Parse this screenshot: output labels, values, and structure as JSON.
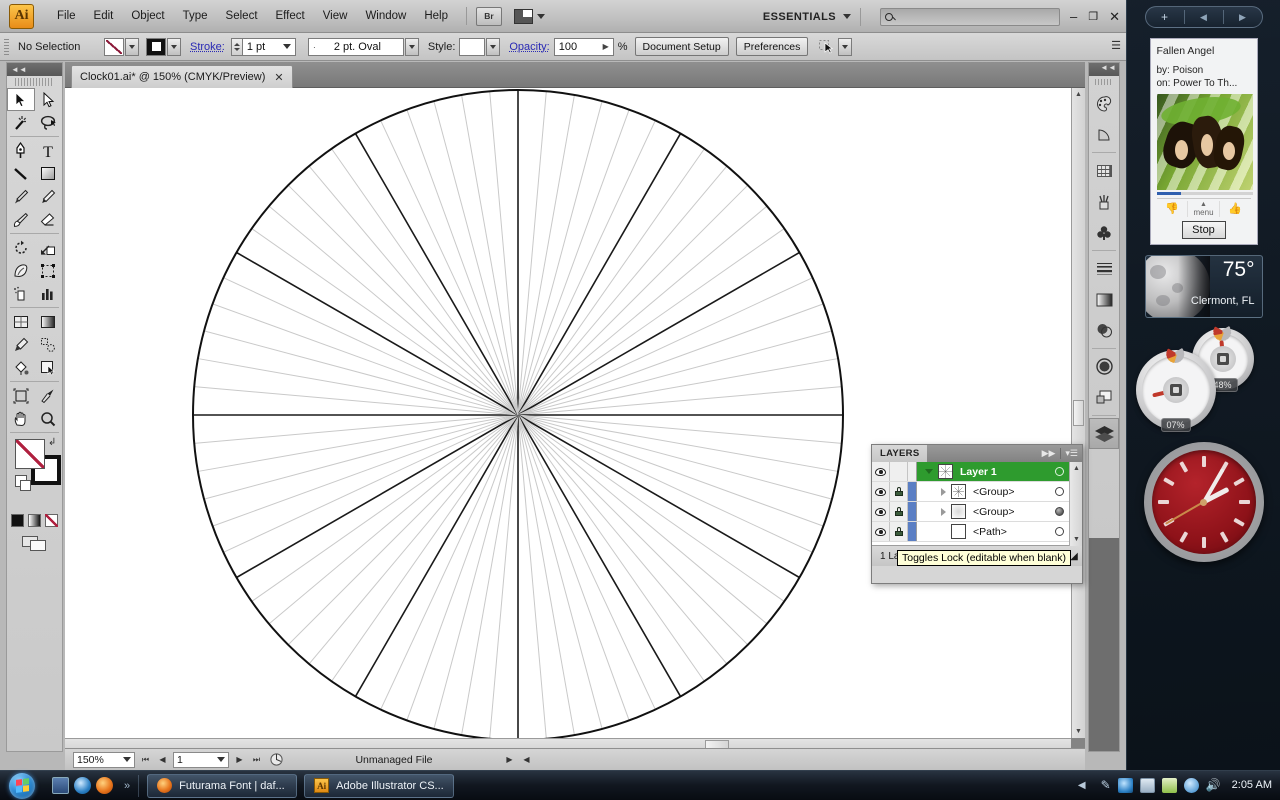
{
  "app": {
    "name": "Adobe Illustrator",
    "logo_text": "Ai",
    "menus": [
      "File",
      "Edit",
      "Object",
      "Type",
      "Select",
      "Effect",
      "View",
      "Window",
      "Help"
    ],
    "bridge_button": "Br",
    "workspace": "ESSENTIALS",
    "search_placeholder": "",
    "window_buttons": {
      "minimize": "–",
      "restore": "❐",
      "close": "✕"
    }
  },
  "control_bar": {
    "selection_status": "No Selection",
    "stroke_label": "Stroke:",
    "stroke_value": "1 pt",
    "brush_value": "2 pt. Oval",
    "style_label": "Style:",
    "opacity_label": "Opacity:",
    "opacity_value": "100",
    "percent": "%",
    "document_setup": "Document Setup",
    "preferences": "Preferences"
  },
  "document": {
    "tab_title": "Clock01.ai* @ 150% (CMYK/Preview)",
    "tab_close": "✕"
  },
  "status_bar": {
    "zoom": "150%",
    "page": "1",
    "status_text": "Unmanaged File"
  },
  "tools": [
    {
      "name": "selection-tool",
      "glyph": "arrow-solid",
      "selected": true
    },
    {
      "name": "direct-selection-tool",
      "glyph": "arrow-outline",
      "selected": false
    },
    {
      "name": "magic-wand-tool",
      "glyph": "wand",
      "selected": false
    },
    {
      "name": "lasso-tool",
      "glyph": "lasso",
      "selected": false
    },
    {
      "name": "pen-tool",
      "glyph": "pen",
      "selected": false
    },
    {
      "name": "type-tool",
      "glyph": "T",
      "selected": false
    },
    {
      "name": "line-segment-tool",
      "glyph": "line",
      "selected": false
    },
    {
      "name": "rectangle-tool",
      "glyph": "rect",
      "selected": false
    },
    {
      "name": "paintbrush-tool",
      "glyph": "brush",
      "selected": false
    },
    {
      "name": "pencil-tool",
      "glyph": "pencil",
      "selected": false
    },
    {
      "name": "blob-brush-tool",
      "glyph": "blob",
      "selected": false
    },
    {
      "name": "eraser-tool",
      "glyph": "eraser",
      "selected": false
    },
    {
      "name": "rotate-tool",
      "glyph": "rotate",
      "selected": false
    },
    {
      "name": "scale-tool",
      "glyph": "scale",
      "selected": false
    },
    {
      "name": "warp-tool",
      "glyph": "warp",
      "selected": false
    },
    {
      "name": "free-transform-tool",
      "glyph": "freetransform",
      "selected": false
    },
    {
      "name": "symbol-sprayer-tool",
      "glyph": "sprayer",
      "selected": false
    },
    {
      "name": "column-graph-tool",
      "glyph": "graph",
      "selected": false
    },
    {
      "name": "mesh-tool",
      "glyph": "mesh",
      "selected": false
    },
    {
      "name": "gradient-tool",
      "glyph": "gradient",
      "selected": false
    },
    {
      "name": "eyedropper-tool",
      "glyph": "eyedropper",
      "selected": false
    },
    {
      "name": "blend-tool",
      "glyph": "blend",
      "selected": false
    },
    {
      "name": "live-paint-bucket-tool",
      "glyph": "bucket",
      "selected": false
    },
    {
      "name": "live-paint-selection-tool",
      "glyph": "paintselect",
      "selected": false
    },
    {
      "name": "artboard-tool",
      "glyph": "artboard",
      "selected": false
    },
    {
      "name": "slice-tool",
      "glyph": "slice",
      "selected": false
    },
    {
      "name": "hand-tool",
      "glyph": "hand",
      "selected": false
    },
    {
      "name": "zoom-tool",
      "glyph": "magnifier",
      "selected": false
    }
  ],
  "right_dock": [
    {
      "name": "color-panel-icon",
      "glyph": "palette"
    },
    {
      "name": "color-guide-panel-icon",
      "glyph": "colorguide"
    },
    {
      "name": "swatches-panel-icon",
      "glyph": "swatches"
    },
    {
      "name": "brushes-panel-icon",
      "glyph": "brushes"
    },
    {
      "name": "symbols-panel-icon",
      "glyph": "symbols"
    },
    {
      "name": "stroke-panel-icon",
      "glyph": "strokelines"
    },
    {
      "name": "gradient-panel-icon",
      "glyph": "gradientbox"
    },
    {
      "name": "transparency-panel-icon",
      "glyph": "transparency"
    },
    {
      "name": "appearance-panel-icon",
      "glyph": "appearance"
    },
    {
      "name": "graphic-styles-panel-icon",
      "glyph": "graphicstyles"
    },
    {
      "name": "layers-panel-icon",
      "glyph": "layers",
      "selected": true
    }
  ],
  "layers_panel": {
    "tab_label": "LAYERS",
    "rows": [
      {
        "name": "Layer 1",
        "type": "layer",
        "selected": true,
        "locked": false,
        "expanded": true,
        "target_filled": false
      },
      {
        "name": "<Group>",
        "type": "group",
        "selected": false,
        "locked": true,
        "expanded": false,
        "target_filled": false
      },
      {
        "name": "<Group>",
        "type": "group",
        "selected": false,
        "locked": true,
        "expanded": false,
        "target_filled": true
      },
      {
        "name": "<Path>",
        "type": "path",
        "selected": false,
        "locked": true,
        "expanded": false,
        "target_filled": false
      }
    ],
    "footer_count": "1 Layer",
    "footer_icons": [
      "make-clipping-mask",
      "create-new-sublayer",
      "create-new-layer",
      "delete-selection"
    ],
    "tooltip": "Toggles Lock (editable when blank)"
  },
  "artwork": {
    "description": "radial clock guide circle",
    "major_spokes": 12,
    "minor_spokes_between": 5,
    "major_color": "#1a1a1a",
    "minor_color": "#c9c9c9",
    "circle_color": "#111111"
  },
  "sidebar": {
    "header": {
      "add": "+",
      "prev": "◀",
      "next": "▶"
    },
    "music_gadget": {
      "title": "Fallen Angel",
      "artist_label": "by: Poison",
      "album_label": "on: Power To Th...",
      "stop_button": "Stop",
      "menu_label": "menu",
      "thumb_down": "👎",
      "thumb_up": "👍",
      "progress_percent": 26
    },
    "weather_gadget": {
      "temperature": "75°",
      "location": "Clermont, FL"
    },
    "cpu_meter": {
      "label": "07%",
      "value": 7
    },
    "memory_meter": {
      "label": "48%",
      "value": 48
    },
    "clock_gadget": {
      "time": "2:05",
      "hour": 2,
      "minute": 5,
      "second": 40
    }
  },
  "taskbar": {
    "start_label": "Start",
    "quick_launch": [
      "show-desktop-icon",
      "internet-explorer-icon",
      "firefox-icon"
    ],
    "overflow_chevron": "»",
    "buttons": [
      {
        "label": "Futurama Font | daf...",
        "icon": "firefox-icon"
      },
      {
        "label": "Adobe Illustrator CS...",
        "icon": "illustrator-icon"
      }
    ],
    "tray_icons": [
      "show-hidden-icons",
      "pen-icon",
      "network-icon",
      "display-icon",
      "usb-icon",
      "sync-icon",
      "volume-icon"
    ],
    "clock": "2:05 AM"
  },
  "colors": {
    "layer_selected": "#2e9b2e",
    "accent_link": "#2a2ab5",
    "tooltip_bg": "#ffffd8",
    "clock_face": "#8e1219"
  }
}
